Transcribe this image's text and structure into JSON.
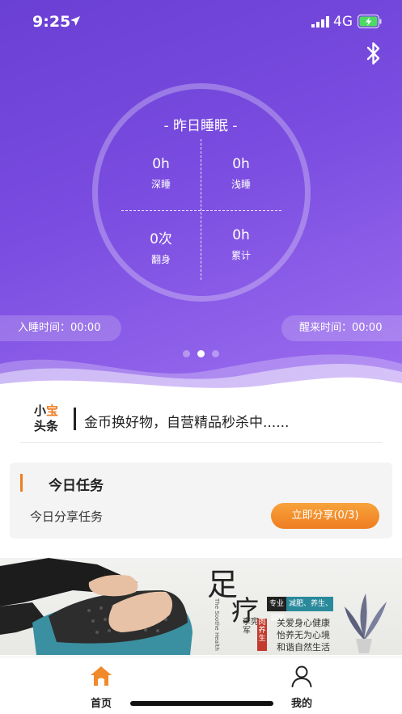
{
  "status_bar": {
    "time": "9:25",
    "network": "4G"
  },
  "sleep": {
    "title": "- 昨日睡眠 -",
    "deep": {
      "value": "0h",
      "label": "深睡"
    },
    "light": {
      "value": "0h",
      "label": "浅睡"
    },
    "turns": {
      "value": "0次",
      "label": "翻身"
    },
    "total": {
      "value": "0h",
      "label": "累计"
    },
    "sleep_time": "入睡时间：00:00",
    "wake_time": "醒来时间：00:00",
    "carousel_active": 2,
    "carousel_count": 3
  },
  "news": {
    "logo_line1_a": "小",
    "logo_line1_b": "宝",
    "logo_line2": "头条",
    "headline": "金币换好物，自营精品秒杀中......"
  },
  "tasks": {
    "title": "今日任务",
    "item_label": "今日分享任务",
    "button_label": "立即分享(0/3)"
  },
  "banner": {
    "big_char1": "足",
    "big_char2": "疗",
    "vertical_name": "李宪军",
    "english": "The Soothe Health",
    "tag_black": "专业",
    "tag_teal": "减肥、养生、调理",
    "tag_red": "肉养生",
    "line1": "关爱身心健康",
    "line2": "怡养无为心境",
    "line3": "和谐自然生活"
  },
  "tabbar": {
    "home_label": "首页",
    "mine_label": "我的"
  },
  "colors": {
    "hero_start": "#6a3fd4",
    "hero_end": "#9d6ef0",
    "accent_orange": "#ef7d22",
    "tab_home_icon": "#f08a2a"
  },
  "icons": [
    "location-arrow-icon",
    "signal-icon",
    "battery-charging-icon",
    "bluetooth-icon",
    "home-icon",
    "user-icon"
  ]
}
